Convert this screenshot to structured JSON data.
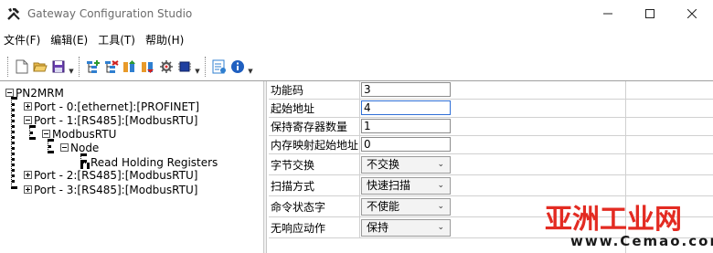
{
  "window": {
    "title": "Gateway Configuration Studio",
    "icons": [
      "tools-icon",
      "minimize-icon",
      "maximize-icon",
      "close-icon"
    ]
  },
  "menu": {
    "items": [
      "文件(F)",
      "编辑(E)",
      "工具(T)",
      "帮助(H)"
    ]
  },
  "toolbar": {
    "buttons": [
      "new-file-icon",
      "open-folder-icon",
      "save-icon",
      "add-node-icon",
      "delete-node-icon",
      "move-up-icon",
      "move-down-icon",
      "settings-icon",
      "chip-icon",
      "config-icon",
      "info-icon"
    ]
  },
  "tree": {
    "root": "PN2MRM",
    "port0": "Port - 0:[ethernet]:[PROFINET]",
    "port1": "Port - 1:[RS485]:[ModbusRTU]",
    "modbus": "ModbusRTU",
    "node": "Node",
    "cmd": "Read Holding Registers",
    "port2": "Port - 2:[RS485]:[ModbusRTU]",
    "port3": "Port - 3:[RS485]:[ModbusRTU]"
  },
  "properties": {
    "rows": [
      {
        "label": "功能码",
        "value": "3"
      },
      {
        "label": "起始地址",
        "value": "4"
      },
      {
        "label": "保持寄存器数量",
        "value": "1"
      },
      {
        "label": "内存映射起始地址",
        "value": "0"
      },
      {
        "label": "字节交换",
        "value": "不交换"
      },
      {
        "label": "扫描方式",
        "value": "快速扫描"
      },
      {
        "label": "命令状态字",
        "value": "不使能"
      },
      {
        "label": "无响应动作",
        "value": "保持"
      }
    ]
  },
  "watermark": {
    "brand": "亚洲工业网",
    "url": "www.Cemao.com"
  },
  "colors": {
    "watermark_red": "#e32b22",
    "focus_border": "#2f6fd6"
  }
}
